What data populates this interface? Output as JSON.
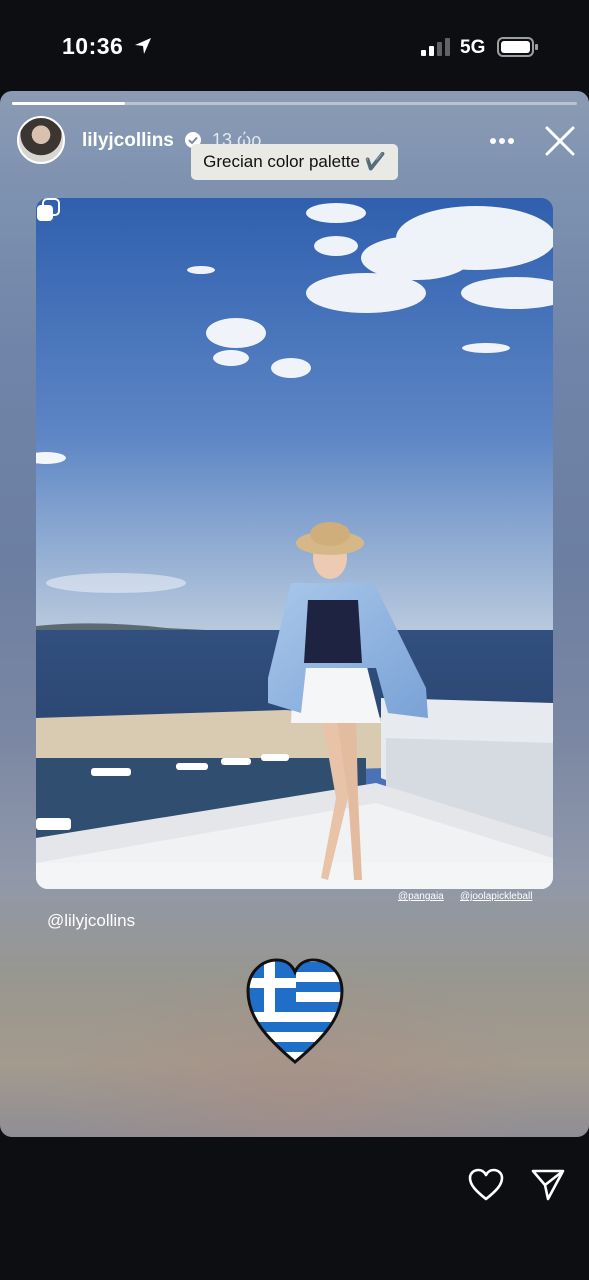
{
  "status_bar": {
    "time": "10:36",
    "network": "5G",
    "icons": [
      "location-arrow-icon",
      "cellular-signal-icon",
      "battery-icon"
    ]
  },
  "story": {
    "progress": 0.2,
    "username": "lilyjcollins",
    "timestamp": "13 ώρ.",
    "caption": "Grecian color palette ✔️",
    "mention": "@lilyjcollins",
    "photo_tags": [
      "@pangaia",
      "@joolapickleball"
    ],
    "icons": [
      "verified-badge-icon",
      "more-options-icon",
      "close-icon",
      "carousel-icon",
      "greek-flag-heart-icon"
    ]
  },
  "actions": {
    "icons": [
      "like-heart-icon",
      "send-icon"
    ]
  }
}
